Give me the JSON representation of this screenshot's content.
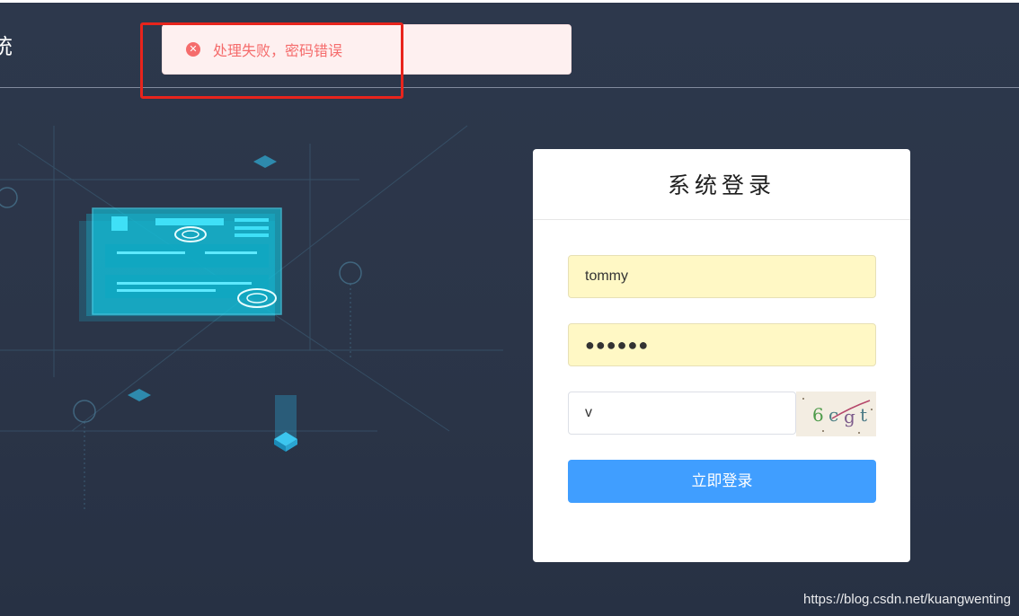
{
  "header": {
    "title_fragment": "统"
  },
  "toast": {
    "icon": "error-circle-icon",
    "message": "处理失败，密码错误",
    "color": "#f56c6c"
  },
  "login": {
    "title": "系统登录",
    "username_value": "tommy",
    "password_value": "●●●●●●",
    "captcha_value": "v",
    "captcha_image_text": "6cgt",
    "submit_label": "立即登录",
    "button_color": "#409eff"
  },
  "watermark": {
    "text": "https://blog.csdn.net/kuangwenting"
  }
}
